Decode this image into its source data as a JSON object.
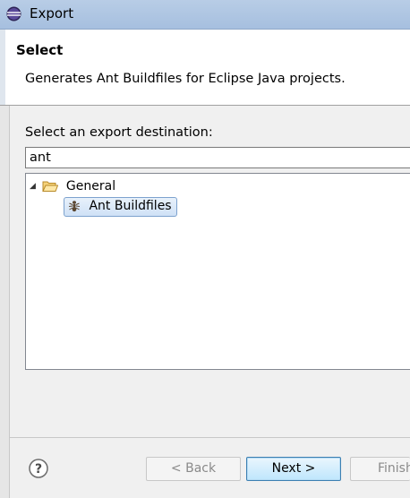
{
  "window": {
    "title": "Export"
  },
  "header": {
    "heading": "Select",
    "description": "Generates Ant Buildfiles for Eclipse Java projects."
  },
  "main": {
    "destination_label": "Select an export destination:",
    "filter_value": "ant",
    "tree": [
      {
        "label": "General",
        "icon": "folder-open-icon",
        "expanded": true,
        "children": [
          {
            "label": "Ant Buildfiles",
            "icon": "ant-icon",
            "selected": true
          }
        ]
      }
    ]
  },
  "footer": {
    "help_icon": "help-icon",
    "back_label": "< Back",
    "next_label": "Next >",
    "finish_label": "Finish"
  },
  "colors": {
    "selection_border": "#7da2ce",
    "selection_fill": "#cfe1f6",
    "default_button_border": "#3c7fb1",
    "folder": "#e8b94a"
  }
}
